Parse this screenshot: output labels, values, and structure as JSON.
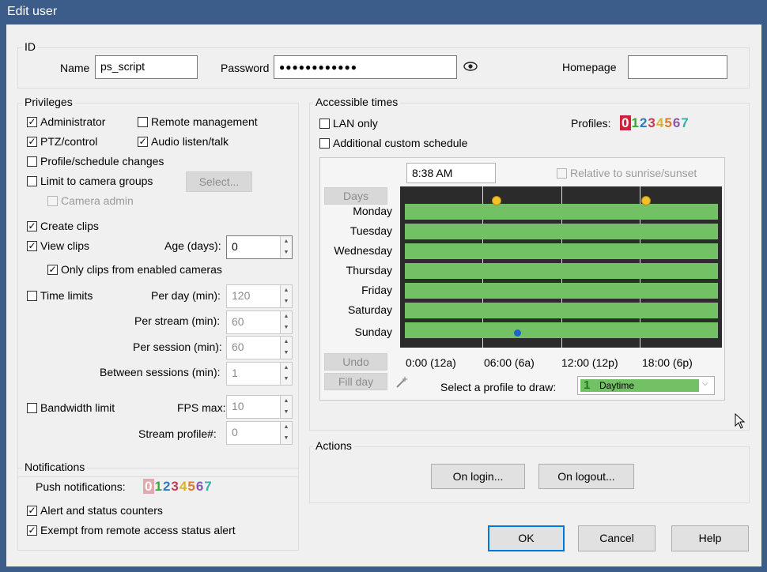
{
  "window": {
    "title": "Edit user"
  },
  "id": {
    "title": "ID",
    "name_label": "Name",
    "name_value": "ps_script",
    "password_label": "Password",
    "password_value": "●●●●●●●●●●●●",
    "homepage_label": "Homepage",
    "homepage_value": ""
  },
  "privileges": {
    "title": "Privileges",
    "administrator": "Administrator",
    "remote_management": "Remote management",
    "ptz_control": "PTZ/control",
    "audio": "Audio listen/talk",
    "profile_changes": "Profile/schedule changes",
    "limit_groups": "Limit to camera groups",
    "select_button": "Select...",
    "camera_admin": "Camera admin",
    "create_clips": "Create clips",
    "view_clips": "View clips",
    "age_label": "Age (days):",
    "age_value": "0",
    "only_enabled": "Only clips from enabled cameras",
    "time_limits": "Time limits",
    "per_day_label": "Per day (min):",
    "per_day_value": "120",
    "per_stream_label": "Per stream (min):",
    "per_stream_value": "60",
    "per_session_label": "Per session (min):",
    "per_session_value": "60",
    "between_label": "Between sessions (min):",
    "between_value": "1",
    "bandwidth_limit": "Bandwidth limit",
    "fps_label": "FPS max:",
    "fps_value": "10",
    "stream_profile_label": "Stream profile#:",
    "stream_profile_value": "0"
  },
  "notifications": {
    "title": "Notifications",
    "push_label": "Push notifications:",
    "alert_counters": "Alert and status counters",
    "exempt": "Exempt from remote access status alert"
  },
  "profiles": {
    "digits": [
      "0",
      "1",
      "2",
      "3",
      "4",
      "5",
      "6",
      "7"
    ],
    "colors": [
      "#d0223a",
      "#3aa63a",
      "#2d7bc2",
      "#c23b52",
      "#d8b42a",
      "#e07a2a",
      "#8b55b0",
      "#3aaea6"
    ]
  },
  "times": {
    "title": "Accessible times",
    "lan_only": "LAN only",
    "custom_schedule": "Additional custom schedule",
    "profiles_label": "Profiles:",
    "time_value": "8:38 AM",
    "relative": "Relative to sunrise/sunset",
    "days_button": "Days",
    "undo_button": "Undo",
    "fill_day_button": "Fill day",
    "days": [
      "Monday",
      "Tuesday",
      "Wednesday",
      "Thursday",
      "Friday",
      "Saturday",
      "Sunday"
    ],
    "axis": [
      "0:00 (12a)",
      "06:00 (6a)",
      "12:00 (12p)",
      "18:00 (6p)"
    ],
    "draw_label": "Select a profile to draw:",
    "draw_value": "Daytime",
    "draw_digit": "1"
  },
  "actions": {
    "title": "Actions",
    "on_login": "On login...",
    "on_logout": "On logout..."
  },
  "buttons": {
    "ok": "OK",
    "cancel": "Cancel",
    "help": "Help"
  }
}
